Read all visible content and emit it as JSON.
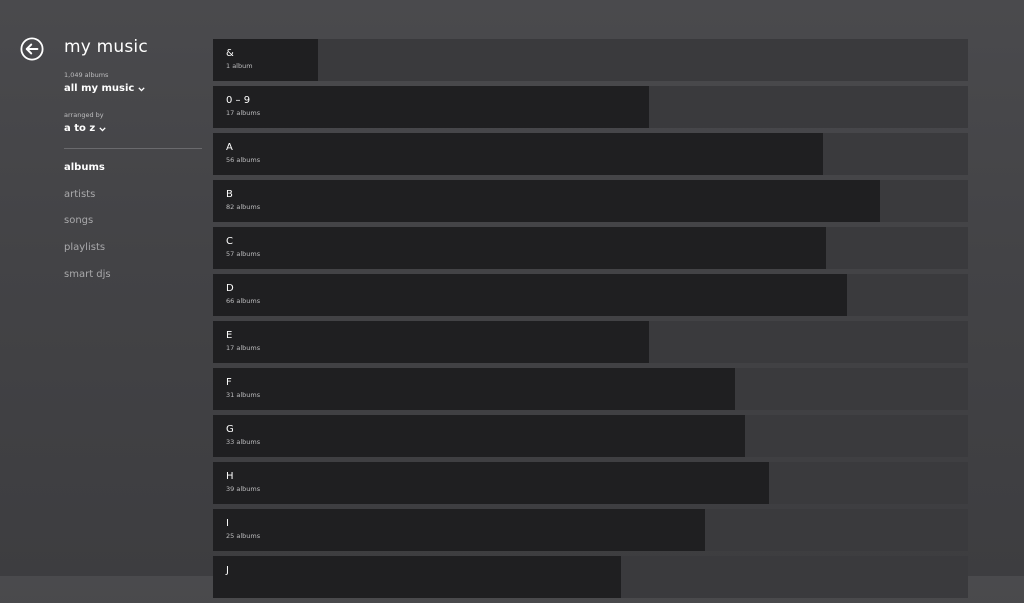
{
  "header": {
    "title": "my music",
    "back_icon": "back-arrow-circle-icon"
  },
  "filter": {
    "count_caption": "1,049 albums",
    "value": "all my music"
  },
  "sort": {
    "caption": "arranged by",
    "value": "a to z"
  },
  "nav": {
    "items": [
      {
        "label": "albums",
        "active": true
      },
      {
        "label": "artists",
        "active": false
      },
      {
        "label": "songs",
        "active": false
      },
      {
        "label": "playlists",
        "active": false
      },
      {
        "label": "smart djs",
        "active": false
      }
    ]
  },
  "groups": [
    {
      "letter": "&",
      "count_label": "1 album",
      "fill": 0.139
    },
    {
      "letter": "0 – 9",
      "count_label": "17 albums",
      "fill": 0.578
    },
    {
      "letter": "A",
      "count_label": "56 albums",
      "fill": 0.808
    },
    {
      "letter": "B",
      "count_label": "82 albums",
      "fill": 0.883
    },
    {
      "letter": "C",
      "count_label": "57 albums",
      "fill": 0.812
    },
    {
      "letter": "D",
      "count_label": "66 albums",
      "fill": 0.84
    },
    {
      "letter": "E",
      "count_label": "17 albums",
      "fill": 0.578
    },
    {
      "letter": "F",
      "count_label": "31 albums",
      "fill": 0.692
    },
    {
      "letter": "G",
      "count_label": "33 albums",
      "fill": 0.705
    },
    {
      "letter": "H",
      "count_label": "39 albums",
      "fill": 0.737
    },
    {
      "letter": "I",
      "count_label": "25 albums",
      "fill": 0.651
    },
    {
      "letter": "J",
      "count_label": "",
      "fill": 0.541
    }
  ],
  "colors": {
    "background": "#444447",
    "tile_track": "#3a3a3d",
    "tile_fill": "#1f1f21",
    "caption": "#bdbdbf",
    "nav_inactive": "#a9a9ab"
  }
}
